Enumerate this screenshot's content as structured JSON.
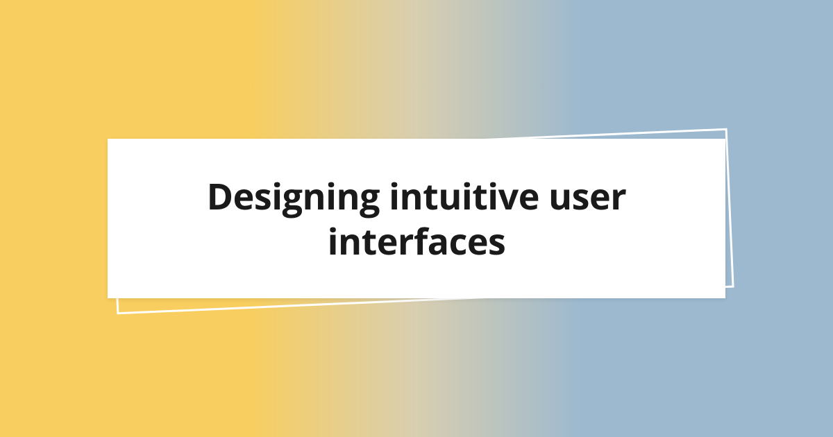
{
  "title": "Designing intuitive user interfaces"
}
